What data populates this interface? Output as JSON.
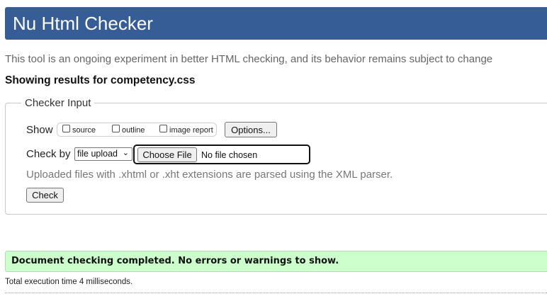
{
  "header": {
    "title": "Nu Html Checker"
  },
  "intro": "This tool is an ongoing experiment in better HTML checking, and its behavior remains subject to change",
  "results_for": "Showing results for competency.css",
  "checker_input": {
    "legend": "Checker Input",
    "show_label": "Show",
    "show_options": [
      {
        "label": "source",
        "checked": false
      },
      {
        "label": "outline",
        "checked": false
      },
      {
        "label": "image report",
        "checked": false
      }
    ],
    "options_button": "Options...",
    "check_by_label": "Check by",
    "check_by_value": "file upload",
    "choose_file_button": "Choose File",
    "file_status": "No file chosen",
    "hint": "Uploaded files with .xhtml or .xht extensions are parsed using the XML parser.",
    "check_button": "Check"
  },
  "result": {
    "message": "Document checking completed. No errors or warnings to show.",
    "execution_time": "Total execution time 4 milliseconds."
  },
  "colors": {
    "header_bg": "#365d95",
    "success_bg": "#ccffcc"
  },
  "icons": {
    "select_chevron": "chevron-down-icon"
  }
}
